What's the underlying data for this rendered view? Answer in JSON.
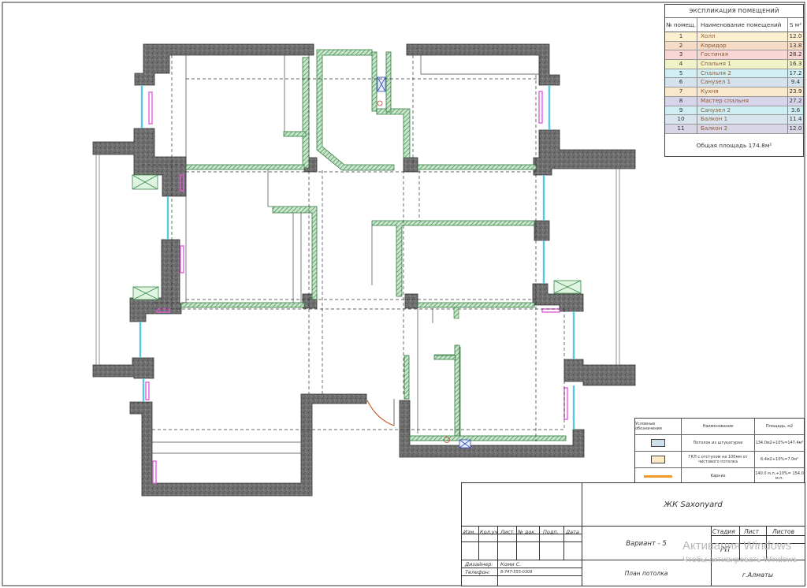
{
  "explication": {
    "title": "ЭКСПЛИКАЦИЯ ПОМЕЩЕНИЙ",
    "col_num": "№ помещ.",
    "col_name": "Наименование помещений",
    "col_area": "S м²",
    "rows": [
      {
        "num": "1",
        "name": "Холл",
        "area": "12.0",
        "color": "#fdf0d0"
      },
      {
        "num": "2",
        "name": "Коридор",
        "area": "13.8",
        "color": "#f6dcc4"
      },
      {
        "num": "3",
        "name": "Гостиная",
        "area": "28.2",
        "color": "#f8d6d6"
      },
      {
        "num": "4",
        "name": "Спальня 1",
        "area": "16.3",
        "color": "#f2f2c8"
      },
      {
        "num": "5",
        "name": "Спальня 2",
        "area": "17.2",
        "color": "#d2f0f4"
      },
      {
        "num": "6",
        "name": "Санузел 1",
        "area": "9.4",
        "color": "#d4e2ec"
      },
      {
        "num": "7",
        "name": "Кухня",
        "area": "23.9",
        "color": "#fae8cc"
      },
      {
        "num": "8",
        "name": "Мастер спальня",
        "area": "27.2",
        "color": "#d8d4ec"
      },
      {
        "num": "9",
        "name": "Санузел 2",
        "area": "3.6",
        "color": "#cfeef2"
      },
      {
        "num": "10",
        "name": "Балкон 1",
        "area": "11.4",
        "color": "#d8e4ee"
      },
      {
        "num": "11",
        "name": "Балкон 2",
        "area": "12.0",
        "color": "#d9d6e6"
      }
    ],
    "total": "Общая площадь 174.8м²"
  },
  "legend": {
    "col1": "Условные обозначения",
    "col2": "Наименование",
    "col3": "Площадь, м2",
    "rows": [
      {
        "swatch": "#cde0ee",
        "name": "Потолок из штукатурки",
        "area": "134.0м2+10%=147.4м²"
      },
      {
        "swatch": "#fbecc6",
        "name": "ГКЛ с отступом на 100мм от чистового потолка",
        "area": "6.4м2+10%=7.0м²"
      },
      {
        "swatch": "#f09a28",
        "name": "Карниз",
        "area": "140.0 м.п.+10%= 154.0 м.п."
      }
    ]
  },
  "stamp": {
    "project": "ЖК Saxonyard",
    "variant": "Вариант - 5",
    "sheet_title": "План потолка",
    "city": "г.Алматы",
    "stage_label": "Стадия",
    "sheet_label": "Лист",
    "sheets_label": "Листов",
    "stage_value": "РП",
    "col_izm": "Изм.",
    "col_kol": "Кол.уч",
    "col_list": "Лист",
    "col_doc": "№ док.",
    "col_podp": "Подп.",
    "col_date": "Дата",
    "designer_label": "Дизайнер:",
    "designer_value": "Коми С.",
    "phone_label": "Телефон:",
    "phone_value": "8-747-555-0309"
  },
  "watermark": {
    "line1": "Активация Windows",
    "line2": "Чтобы активировать Windows"
  },
  "colors": {
    "wall_fill": "#6f6f6f",
    "partition_fill": "#bfe0c4",
    "partition_stroke": "#2f7a3a",
    "window_glass": "#9fe3f2",
    "radiator": "#e060d8",
    "door_arc": "#c0581c"
  }
}
